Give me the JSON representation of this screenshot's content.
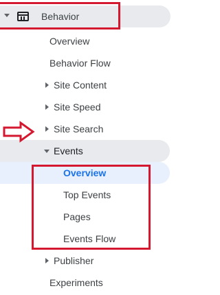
{
  "nav": {
    "behavior": {
      "label": "Behavior",
      "icon": "report-icon",
      "expanded": true
    },
    "behavior_children": [
      {
        "label": "Overview"
      },
      {
        "label": "Behavior Flow"
      },
      {
        "label": "Site Content"
      },
      {
        "label": "Site Speed"
      },
      {
        "label": "Site Search"
      },
      {
        "label": "Events"
      },
      {
        "label": "Publisher"
      },
      {
        "label": "Experiments"
      }
    ],
    "events_children": [
      {
        "label": "Overview"
      },
      {
        "label": "Top Events"
      },
      {
        "label": "Pages"
      },
      {
        "label": "Events Flow"
      }
    ]
  },
  "colors": {
    "annotation_red": "#d3182f",
    "active_blue": "#1a73e8",
    "selected_bg": "#e8f0fe",
    "hover_bg": "#e8eaed",
    "text": "#3c4043"
  }
}
